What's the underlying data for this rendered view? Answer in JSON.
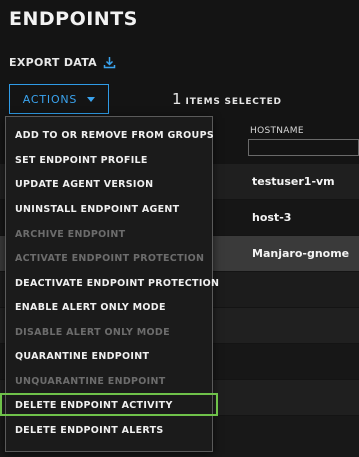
{
  "page": {
    "title": "ENDPOINTS"
  },
  "toolbar": {
    "export_label": "EXPORT DATA",
    "export_icon": "download-icon",
    "actions_label": "ACTIONS",
    "selected_count": "1",
    "selected_label": "ITEMS SELECTED"
  },
  "table": {
    "columns": [
      "HOSTNAME"
    ],
    "rows": [
      {
        "hostname": "testuser1-vm"
      },
      {
        "hostname": "host-3"
      },
      {
        "hostname": "Manjaro-gnome",
        "selected": true
      }
    ]
  },
  "menu": {
    "items": [
      {
        "label": "ADD TO OR REMOVE FROM GROUPS",
        "enabled": true
      },
      {
        "label": "SET ENDPOINT PROFILE",
        "enabled": true
      },
      {
        "label": "UPDATE AGENT VERSION",
        "enabled": true
      },
      {
        "label": "UNINSTALL ENDPOINT AGENT",
        "enabled": true
      },
      {
        "label": "ARCHIVE ENDPOINT",
        "enabled": false
      },
      {
        "label": "ACTIVATE ENDPOINT PROTECTION",
        "enabled": false
      },
      {
        "label": "DEACTIVATE ENDPOINT PROTECTION",
        "enabled": true
      },
      {
        "label": "ENABLE ALERT ONLY MODE",
        "enabled": true
      },
      {
        "label": "DISABLE ALERT ONLY MODE",
        "enabled": false
      },
      {
        "label": "QUARANTINE ENDPOINT",
        "enabled": true
      },
      {
        "label": "UNQUARANTINE ENDPOINT",
        "enabled": false
      },
      {
        "label": "DELETE ENDPOINT ACTIVITY",
        "enabled": true,
        "highlighted": true
      },
      {
        "label": "DELETE ENDPOINT ALERTS",
        "enabled": true
      }
    ]
  },
  "colors": {
    "accent": "#2f9be6",
    "highlight": "#6fc24a",
    "background": "#141414"
  }
}
